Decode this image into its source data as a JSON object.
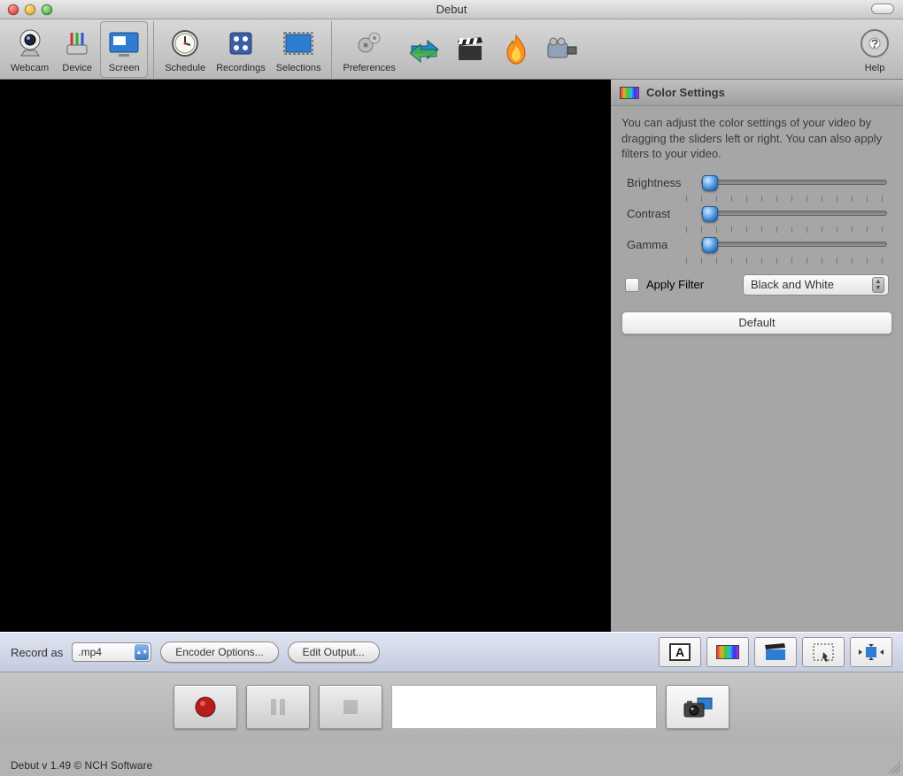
{
  "window": {
    "title": "Debut"
  },
  "toolbar": {
    "webcam": "Webcam",
    "device": "Device",
    "screen": "Screen",
    "schedule": "Schedule",
    "recordings": "Recordings",
    "selections": "Selections",
    "preferences": "Preferences",
    "help": "Help"
  },
  "panel": {
    "title": "Color Settings",
    "description": "You can adjust the color settings of your video by dragging the sliders left or right. You can also apply filters to your video.",
    "brightness_label": "Brightness",
    "contrast_label": "Contrast",
    "gamma_label": "Gamma",
    "apply_filter_label": "Apply Filter",
    "filter_selected": "Black and White",
    "default_label": "Default"
  },
  "options": {
    "record_as_label": "Record as",
    "format_selected": ".mp4",
    "encoder_btn": "Encoder Options...",
    "edit_output_btn": "Edit Output..."
  },
  "footer": {
    "text": "Debut v 1.49 © NCH Software"
  }
}
